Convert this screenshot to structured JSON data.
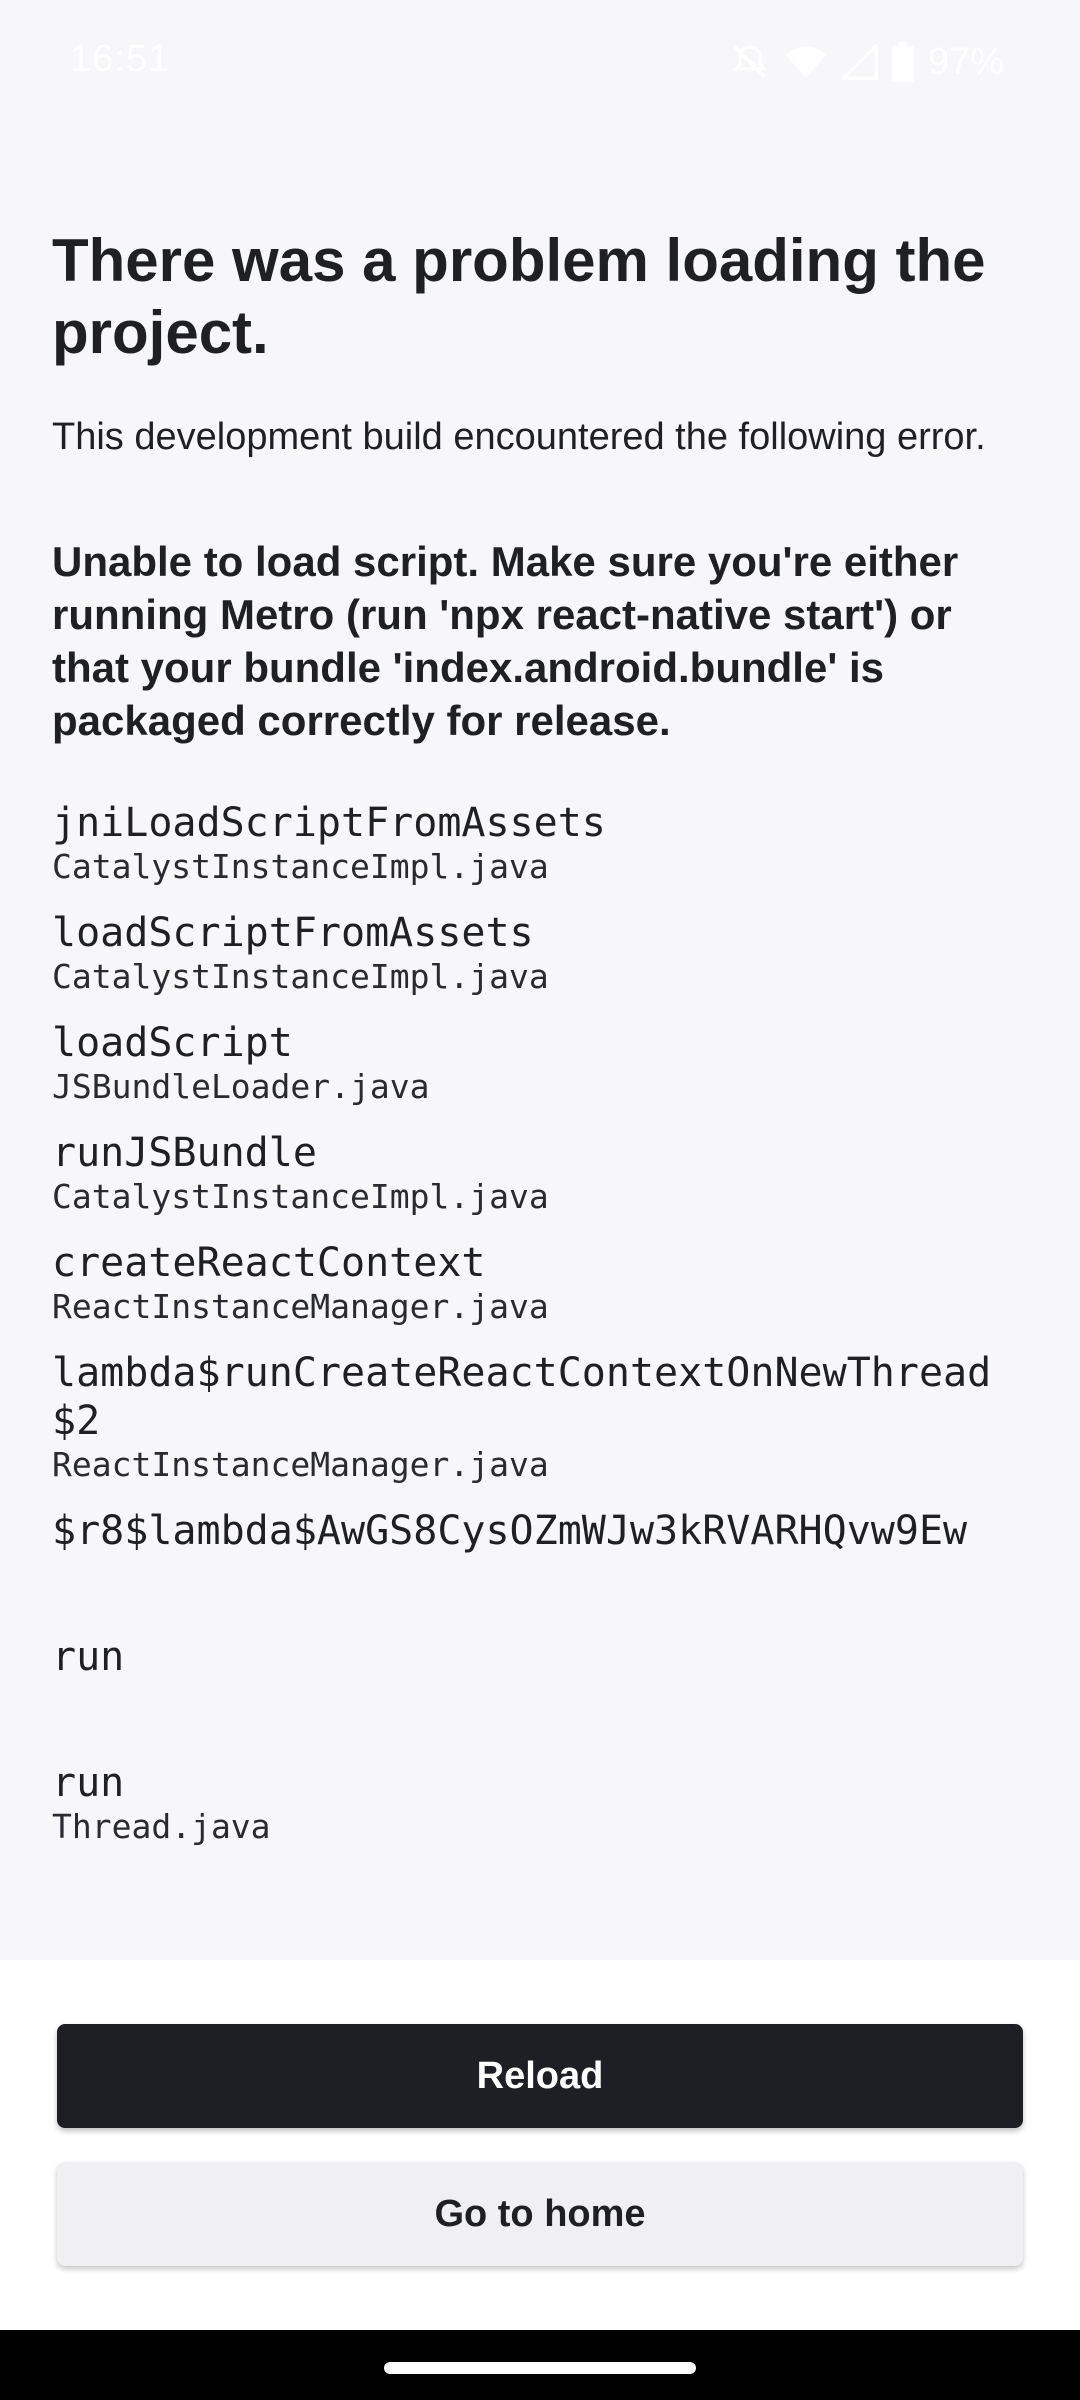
{
  "status_bar": {
    "time": "16:51",
    "battery_percent": "97%",
    "icons": [
      "notifications-muted-icon",
      "wifi-icon",
      "cellular-signal-icon",
      "battery-icon"
    ]
  },
  "error_screen": {
    "title": "There was a problem loading the project.",
    "subtitle": "This development build encountered the following error.",
    "message": "Unable to load script. Make sure you're either running Metro (run 'npx react-native start') or that your bundle 'index.android.bundle' is packaged correctly for release.",
    "stack": [
      {
        "method": "jniLoadScriptFromAssets",
        "file": "CatalystInstanceImpl.java"
      },
      {
        "method": "loadScriptFromAssets",
        "file": "CatalystInstanceImpl.java"
      },
      {
        "method": "loadScript",
        "file": "JSBundleLoader.java"
      },
      {
        "method": "runJSBundle",
        "file": "CatalystInstanceImpl.java"
      },
      {
        "method": "createReactContext",
        "file": "ReactInstanceManager.java"
      },
      {
        "method": "lambda$runCreateReactContextOnNewThread$2",
        "file": "ReactInstanceManager.java"
      },
      {
        "method": "$r8$lambda$AwGS8CysOZmWJw3kRVARHQvw9Ew",
        "file": ""
      },
      {
        "method": "run",
        "file": ""
      },
      {
        "method": "run",
        "file": "Thread.java"
      }
    ]
  },
  "actions": {
    "reload_label": "Reload",
    "home_label": "Go to home"
  },
  "colors": {
    "background": "#f7f7f9",
    "primary_button": "#1d1f24",
    "secondary_button": "#f0f0f3",
    "text": "#1f2024"
  }
}
